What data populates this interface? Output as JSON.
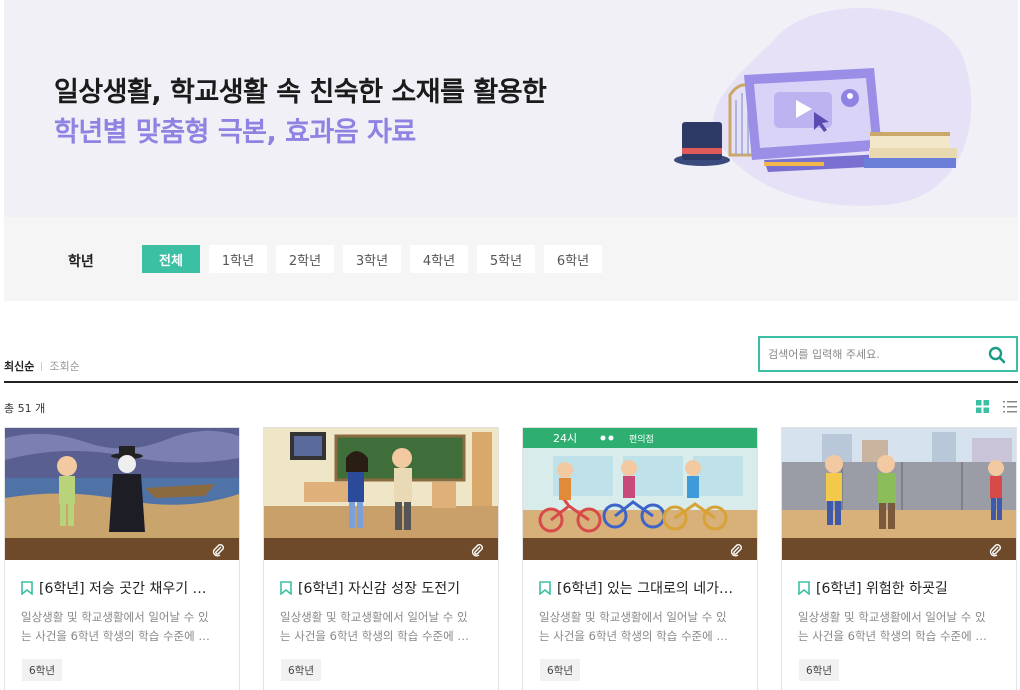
{
  "hero": {
    "title": "일상생활, 학교생활 속 친숙한 소재를 활용한",
    "subtitle": "학년별 맞춤형 극본, 효과음 자료"
  },
  "filter": {
    "label": "학년",
    "grades": [
      "전체",
      "1학년",
      "2학년",
      "3학년",
      "4학년",
      "5학년",
      "6학년"
    ],
    "active": "전체"
  },
  "sort": {
    "latest": "최신순",
    "views": "조회순",
    "active": "최신순"
  },
  "search": {
    "placeholder": "검색어를 입력해 주세요.",
    "value": ""
  },
  "total": "총 51 개",
  "accent_color": "#3cc0a4",
  "hero_accent": "#8e83e2",
  "cards": [
    {
      "title": "[6학년] 저승 곳간 채우기 …",
      "desc1": "일상생활 및 학교생활에서 일어날 수 있",
      "desc2": "는 사건을 6학년 학생의 학습 수준에 …",
      "tag": "6학년"
    },
    {
      "title": "[6학년] 자신감 성장 도전기",
      "desc1": "일상생활 및 학교생활에서 일어날 수 있",
      "desc2": "는 사건을 6학년 학생의 학습 수준에 …",
      "tag": "6학년"
    },
    {
      "title": "[6학년] 있는 그대로의 네가…",
      "desc1": "일상생활 및 학교생활에서 일어날 수 있",
      "desc2": "는 사건을 6학년 학생의 학습 수준에 …",
      "tag": "6학년"
    },
    {
      "title": "[6학년] 위험한 하굣길",
      "desc1": "일상생활 및 학교생활에서 일어날 수 있",
      "desc2": "는 사건을 6학년 학생의 학습 수준에 …",
      "tag": "6학년"
    }
  ],
  "thumbnail_text": {
    "sign1": "24시",
    "sign2": "편의점"
  }
}
